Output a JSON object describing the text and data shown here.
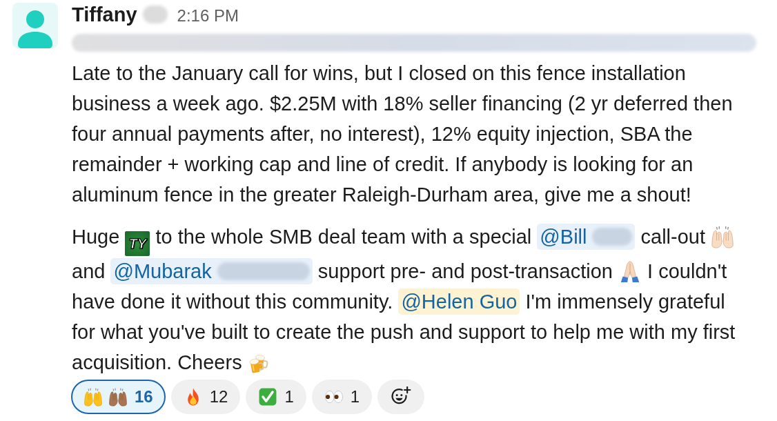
{
  "message": {
    "author": {
      "name": "Tiffany",
      "surname_redacted": true
    },
    "time": "2:16 PM",
    "context_redacted": true,
    "paragraphs": [
      {
        "segments": [
          {
            "kind": "text",
            "text": "Late to the January call for wins, but I closed on this fence installation business a week ago. $2.25M with 18% seller financing (2 yr deferred then four annual payments after, no interest), 12% equity injection, SBA the remainder + working cap and line of credit. If anybody is looking for an aluminum fence in the greater Raleigh-Durham area, give me a shout!"
          }
        ]
      },
      {
        "segments": [
          {
            "kind": "text",
            "text": "Huge "
          },
          {
            "kind": "sticker",
            "text": "TY"
          },
          {
            "kind": "text",
            "text": " to the whole SMB deal team with a special "
          },
          {
            "kind": "mention",
            "text": "@Bill",
            "redacted": true,
            "highlighted": false
          },
          {
            "kind": "text",
            "text": " call-out "
          },
          {
            "kind": "emoji"
          },
          {
            "kind": "text",
            "text": " and "
          },
          {
            "kind": "mention",
            "text": "@Mubarak",
            "redacted": true,
            "highlighted": false
          },
          {
            "kind": "text",
            "text": " support pre- and post-transaction "
          },
          {
            "kind": "emoji"
          },
          {
            "kind": "text",
            "text": " I couldn't have done it without this community. "
          },
          {
            "kind": "mention",
            "text": "@Helen Guo",
            "redacted": false,
            "highlighted": true
          },
          {
            "kind": "text",
            "text": " I'm immensely grateful for what you've built to create the push and support to help me with my first acquisition. Cheers "
          },
          {
            "kind": "emoji"
          }
        ]
      }
    ],
    "reactions": [
      {
        "count": "16",
        "selected": true
      },
      {
        "count": "12",
        "selected": false
      },
      {
        "count": "1",
        "selected": false
      },
      {
        "count": "1",
        "selected": false
      }
    ]
  }
}
